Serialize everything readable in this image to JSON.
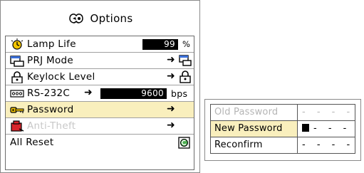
{
  "menu": {
    "title": "Options",
    "items": [
      {
        "label": "Lamp Life",
        "value": "99",
        "unit": "%",
        "icon": "lamp-life-icon"
      },
      {
        "label": "PRJ Mode",
        "icon": "prj-mode-icon"
      },
      {
        "label": "Keylock Level",
        "icon": "lock-icon"
      },
      {
        "label": "RS-232C",
        "value": "9600",
        "unit": "bps",
        "icon": "rs232c-icon"
      },
      {
        "label": "Password",
        "icon": "key-icon",
        "selected": true
      },
      {
        "label": "Anti-Theft",
        "icon": "anti-theft-icon",
        "disabled": true
      },
      {
        "label": "All Reset",
        "icon": "reset-icon"
      }
    ],
    "arrow": "➜"
  },
  "password": {
    "old_label": "Old Password",
    "old_value": "- - - -",
    "new_label": "New Password",
    "new_value": "- - -",
    "reconfirm_label": "Reconfirm",
    "reconfirm_value": "- - - -"
  },
  "colors": {
    "selected_bg": "#f9efbd",
    "disabled_text": "#c8c8c8",
    "border": "#8a8a8a"
  }
}
